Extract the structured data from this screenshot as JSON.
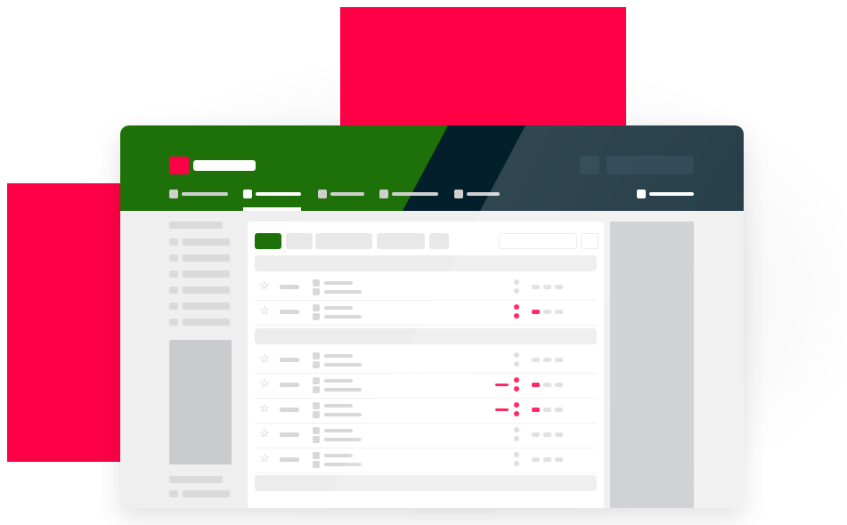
{
  "colors": {
    "accent_red": "#ff0046",
    "header_green": "#1e7009",
    "header_navy": "#031f2c",
    "panel_gray": "#c8cccc",
    "placeholder_gray": "#dadada"
  },
  "header": {
    "logo_icon": "logo-square-icon",
    "nav_items": [
      {
        "name": "nav-item-1",
        "active": false
      },
      {
        "name": "nav-item-2",
        "active": true
      },
      {
        "name": "nav-item-3",
        "active": false
      },
      {
        "name": "nav-item-4",
        "active": false
      },
      {
        "name": "nav-item-5",
        "active": false
      }
    ],
    "right_nav_item": "nav-item-account"
  },
  "icons": {
    "star": "☆",
    "star_icon": "star-icon"
  },
  "match_list": {
    "groups": [
      {
        "name": "group-1",
        "rows": [
          {
            "live": false,
            "highlight_odd": false,
            "goal": false
          },
          {
            "live": true,
            "highlight_odd": true,
            "goal": false
          }
        ]
      },
      {
        "name": "group-2",
        "rows": [
          {
            "live": false,
            "highlight_odd": false,
            "goal": false
          },
          {
            "live": true,
            "highlight_odd": true,
            "goal": true
          },
          {
            "live": true,
            "highlight_odd": true,
            "goal": true
          },
          {
            "live": false,
            "highlight_odd": false,
            "goal": false
          },
          {
            "live": false,
            "highlight_odd": false,
            "goal": false
          }
        ]
      }
    ]
  }
}
